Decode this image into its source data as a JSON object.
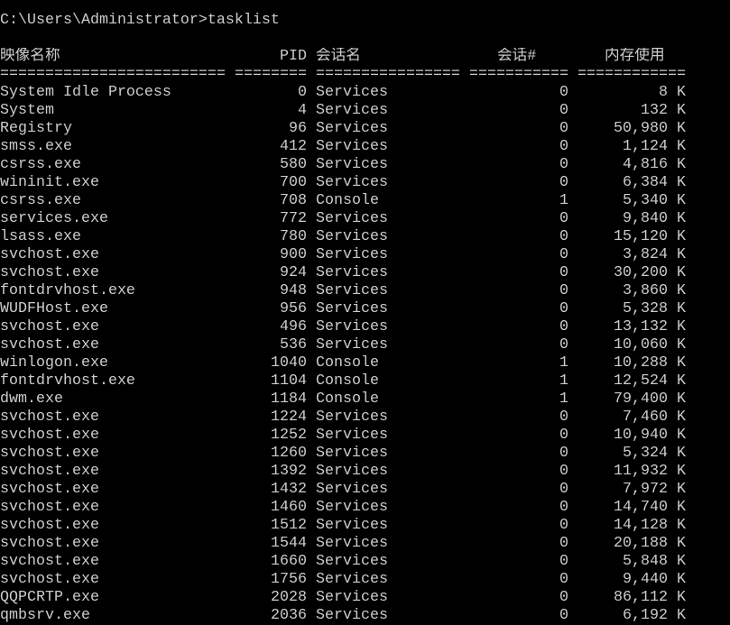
{
  "console": {
    "prompt": "C:\\Users\\Administrator>",
    "command": "tasklist"
  },
  "tasklist": {
    "headers": {
      "image": "映像名称",
      "pid": "PID",
      "session": "会话名",
      "session_no": "会话#",
      "mem": "内存使用"
    },
    "separators": {
      "image": "=========================",
      "pid": "========",
      "session": "================",
      "session_no": "===========",
      "mem": "============"
    },
    "rows": [
      {
        "image": "System Idle Process",
        "pid": "0",
        "session": "Services",
        "session_no": "0",
        "mem": "8 K"
      },
      {
        "image": "System",
        "pid": "4",
        "session": "Services",
        "session_no": "0",
        "mem": "132 K"
      },
      {
        "image": "Registry",
        "pid": "96",
        "session": "Services",
        "session_no": "0",
        "mem": "50,980 K"
      },
      {
        "image": "smss.exe",
        "pid": "412",
        "session": "Services",
        "session_no": "0",
        "mem": "1,124 K"
      },
      {
        "image": "csrss.exe",
        "pid": "580",
        "session": "Services",
        "session_no": "0",
        "mem": "4,816 K"
      },
      {
        "image": "wininit.exe",
        "pid": "700",
        "session": "Services",
        "session_no": "0",
        "mem": "6,384 K"
      },
      {
        "image": "csrss.exe",
        "pid": "708",
        "session": "Console",
        "session_no": "1",
        "mem": "5,340 K"
      },
      {
        "image": "services.exe",
        "pid": "772",
        "session": "Services",
        "session_no": "0",
        "mem": "9,840 K"
      },
      {
        "image": "lsass.exe",
        "pid": "780",
        "session": "Services",
        "session_no": "0",
        "mem": "15,120 K"
      },
      {
        "image": "svchost.exe",
        "pid": "900",
        "session": "Services",
        "session_no": "0",
        "mem": "3,824 K"
      },
      {
        "image": "svchost.exe",
        "pid": "924",
        "session": "Services",
        "session_no": "0",
        "mem": "30,200 K"
      },
      {
        "image": "fontdrvhost.exe",
        "pid": "948",
        "session": "Services",
        "session_no": "0",
        "mem": "3,860 K"
      },
      {
        "image": "WUDFHost.exe",
        "pid": "956",
        "session": "Services",
        "session_no": "0",
        "mem": "5,328 K"
      },
      {
        "image": "svchost.exe",
        "pid": "496",
        "session": "Services",
        "session_no": "0",
        "mem": "13,132 K"
      },
      {
        "image": "svchost.exe",
        "pid": "536",
        "session": "Services",
        "session_no": "0",
        "mem": "10,060 K"
      },
      {
        "image": "winlogon.exe",
        "pid": "1040",
        "session": "Console",
        "session_no": "1",
        "mem": "10,288 K"
      },
      {
        "image": "fontdrvhost.exe",
        "pid": "1104",
        "session": "Console",
        "session_no": "1",
        "mem": "12,524 K"
      },
      {
        "image": "dwm.exe",
        "pid": "1184",
        "session": "Console",
        "session_no": "1",
        "mem": "79,400 K"
      },
      {
        "image": "svchost.exe",
        "pid": "1224",
        "session": "Services",
        "session_no": "0",
        "mem": "7,460 K"
      },
      {
        "image": "svchost.exe",
        "pid": "1252",
        "session": "Services",
        "session_no": "0",
        "mem": "10,940 K"
      },
      {
        "image": "svchost.exe",
        "pid": "1260",
        "session": "Services",
        "session_no": "0",
        "mem": "5,324 K"
      },
      {
        "image": "svchost.exe",
        "pid": "1392",
        "session": "Services",
        "session_no": "0",
        "mem": "11,932 K"
      },
      {
        "image": "svchost.exe",
        "pid": "1432",
        "session": "Services",
        "session_no": "0",
        "mem": "7,972 K"
      },
      {
        "image": "svchost.exe",
        "pid": "1460",
        "session": "Services",
        "session_no": "0",
        "mem": "14,740 K"
      },
      {
        "image": "svchost.exe",
        "pid": "1512",
        "session": "Services",
        "session_no": "0",
        "mem": "14,128 K"
      },
      {
        "image": "svchost.exe",
        "pid": "1544",
        "session": "Services",
        "session_no": "0",
        "mem": "20,188 K"
      },
      {
        "image": "svchost.exe",
        "pid": "1660",
        "session": "Services",
        "session_no": "0",
        "mem": "5,848 K"
      },
      {
        "image": "svchost.exe",
        "pid": "1756",
        "session": "Services",
        "session_no": "0",
        "mem": "9,440 K"
      },
      {
        "image": "QQPCRTP.exe",
        "pid": "2028",
        "session": "Services",
        "session_no": "0",
        "mem": "86,112 K"
      },
      {
        "image": "qmbsrv.exe",
        "pid": "2036",
        "session": "Services",
        "session_no": "0",
        "mem": "6,192 K"
      }
    ]
  },
  "colors": {
    "background": "#000000",
    "text": "#CCCCCC"
  }
}
